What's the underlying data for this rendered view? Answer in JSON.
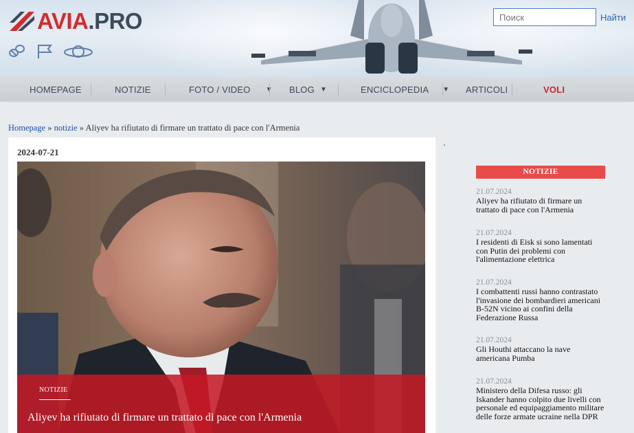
{
  "site": {
    "logo_text_red": "AVIA",
    "logo_text_blue": ".PRO",
    "logo_icons": [
      "pills-icon",
      "flag-icon",
      "planet-icon"
    ]
  },
  "search": {
    "placeholder": "Поиск",
    "button_label": "Найти"
  },
  "nav": {
    "items": [
      {
        "label": "HOMEPAGE",
        "dropdown": false
      },
      {
        "label": "NOTIZIE",
        "dropdown": false
      },
      {
        "label": "FOTO / VIDEO",
        "dropdown": true
      },
      {
        "label": "BLOG",
        "dropdown": true
      },
      {
        "label": "ENCICLOPEDIA",
        "dropdown": true
      },
      {
        "label": "ARTICOLI",
        "dropdown": false
      },
      {
        "label": "VOLI",
        "dropdown": false
      }
    ]
  },
  "breadcrumb": {
    "home": "Homepage",
    "sep1": " » ",
    "section": "notizie",
    "sep2": " » ",
    "current": "Aliyev ha rifiutato di firmare un trattato di pace con l'Armenia"
  },
  "article": {
    "date": "2024-07-21",
    "category": "NOTIZIE",
    "title": "Aliyev ha rifiutato di firmare un trattato di pace con l'Armenia"
  },
  "sidebar": {
    "header": "NOTIZIE",
    "items": [
      {
        "date": "21.07.2024",
        "title": "Aliyev ha rifiutato di firmare un trattato di pace con l'Armenia"
      },
      {
        "date": "21.07.2024",
        "title": "I residenti di Eisk si sono lamentati con Putin dei problemi con l'alimentazione elettrica"
      },
      {
        "date": "21.07.2024",
        "title": "I combattenti russi hanno contrastato l'invasione dei bombardieri americani B-52N vicino ai confini della Federazione Russa"
      },
      {
        "date": "21.07.2024",
        "title": "Gli Houthi attaccano la nave americana Pumba"
      },
      {
        "date": "21.07.2024",
        "title": "Ministero della Difesa russo: gli Iskander hanno colpito due livelli con personale ed equipaggiamento militare delle forze armate ucraine nella DPR"
      }
    ]
  },
  "colors": {
    "brand_red": "#d52b2b",
    "overlay_red": "#c41824",
    "sidebar_header": "#e94a4a",
    "link_blue": "#1a4fa8"
  }
}
